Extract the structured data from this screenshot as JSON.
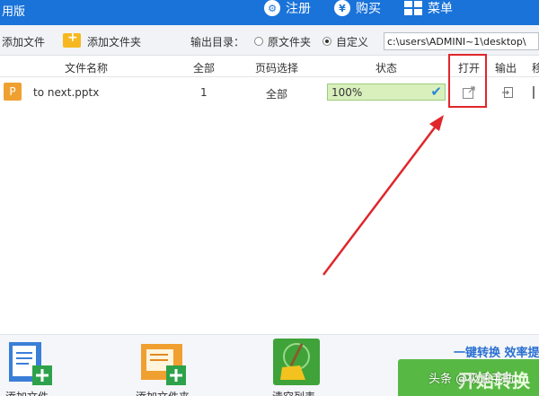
{
  "app": {
    "title_partial": "用版"
  },
  "topbar": {
    "register_label": "注册",
    "buy_label": "购买",
    "menu_label": "菜单"
  },
  "toolbar": {
    "add_file_label": "添加文件",
    "add_folder_label": "添加文件夹",
    "output_dir_label": "输出目录：",
    "original_folder_label": "原文件夹",
    "custom_label": "自定义",
    "output_path": "c:\\users\\ADMINI~1\\desktop\\",
    "selected_option": "custom"
  },
  "table": {
    "headers": {
      "file_name": "文件名称",
      "all": "全部",
      "page_select": "页码选择",
      "status": "状态",
      "open": "打开",
      "export": "输出",
      "more_partial": "移"
    },
    "rows": [
      {
        "file_icon_letter": "P",
        "file_name": "to next.pptx",
        "pages": "1",
        "page_select": "全部",
        "progress_text": "100%",
        "progress_value": 100
      }
    ]
  },
  "bottom": {
    "add_file_label_partial": "添加文件",
    "add_folder_label_partial": "添加文件夹",
    "clear_list_label_partial": "清空列表",
    "promo_text": "一键转换  效率提",
    "convert_label_partial": "开始转换"
  },
  "watermark": "头条 @极速手助",
  "colors": {
    "topbar": "#1a73d9",
    "highlight": "#e0262b",
    "convert": "#57b944",
    "progress": "#d9f0bd"
  },
  "icons": [
    "register-icon",
    "buy-icon",
    "menu-icon",
    "folder-add-icon",
    "open-file-icon",
    "export-icon",
    "check-icon",
    "clear-list-icon"
  ]
}
